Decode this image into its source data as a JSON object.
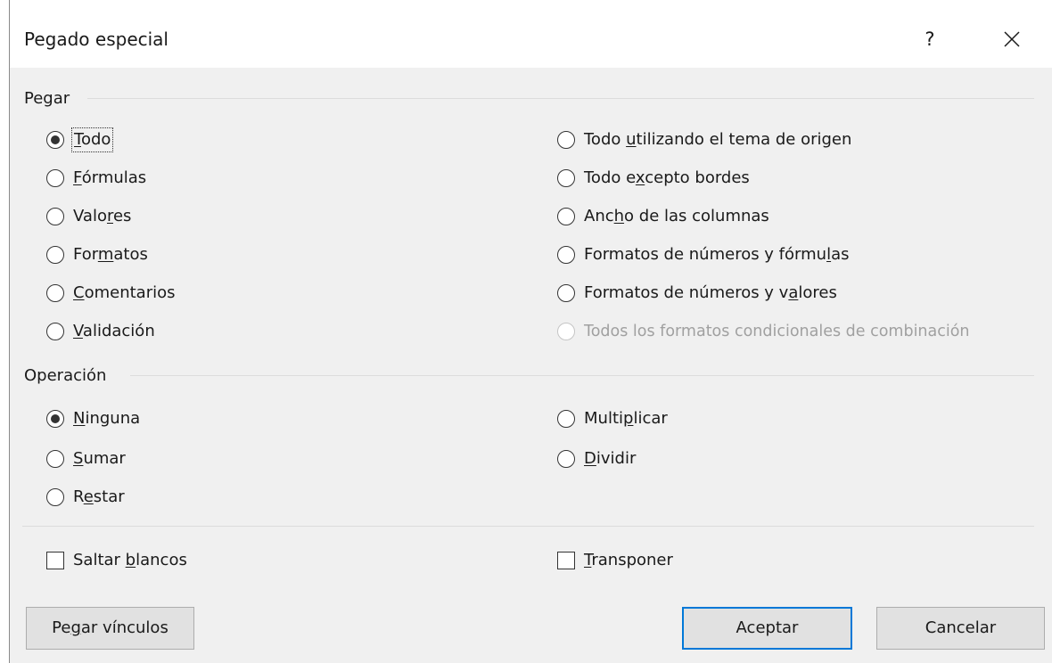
{
  "dialog": {
    "title": "Pegado especial",
    "help_label": "?",
    "close_icon": "close-icon"
  },
  "paste": {
    "label": "Pegar",
    "left_options": [
      {
        "pre": "",
        "key": "T",
        "post": "odo",
        "checked": true,
        "disabled": false
      },
      {
        "pre": "",
        "key": "F",
        "post": "órmulas",
        "checked": false,
        "disabled": false
      },
      {
        "pre": "Valo",
        "key": "r",
        "post": "es",
        "checked": false,
        "disabled": false
      },
      {
        "pre": "For",
        "key": "m",
        "post": "atos",
        "checked": false,
        "disabled": false
      },
      {
        "pre": "",
        "key": "C",
        "post": "omentarios",
        "checked": false,
        "disabled": false
      },
      {
        "pre": "",
        "key": "V",
        "post": "alidación",
        "checked": false,
        "disabled": false
      }
    ],
    "right_options": [
      {
        "pre": "Todo ",
        "key": "u",
        "post": "tilizando el tema de origen",
        "checked": false,
        "disabled": false
      },
      {
        "pre": "Todo e",
        "key": "x",
        "post": "cepto bordes",
        "checked": false,
        "disabled": false
      },
      {
        "pre": "Anc",
        "key": "h",
        "post": "o de las columnas",
        "checked": false,
        "disabled": false
      },
      {
        "pre": "Formatos de números y fórmu",
        "key": "l",
        "post": "as",
        "checked": false,
        "disabled": false
      },
      {
        "pre": "Formatos de números y v",
        "key": "a",
        "post": "lores",
        "checked": false,
        "disabled": false
      },
      {
        "pre": "Todos los formatos condicionales de combinación",
        "key": "",
        "post": "",
        "checked": false,
        "disabled": true
      }
    ]
  },
  "operation": {
    "label": "Operación",
    "left_options": [
      {
        "pre": "",
        "key": "N",
        "post": "inguna",
        "checked": true
      },
      {
        "pre": "",
        "key": "S",
        "post": "umar",
        "checked": false
      },
      {
        "pre": "R",
        "key": "e",
        "post": "star",
        "checked": false
      }
    ],
    "right_options": [
      {
        "pre": "Multi",
        "key": "p",
        "post": "licar",
        "checked": false
      },
      {
        "pre": "",
        "key": "D",
        "post": "ividir",
        "checked": false
      }
    ]
  },
  "checkboxes": {
    "skip_blanks": {
      "pre": "Saltar ",
      "key": "b",
      "post": "lancos",
      "checked": false
    },
    "transpose": {
      "pre": "",
      "key": "T",
      "post": "ransponer",
      "checked": false
    }
  },
  "buttons": {
    "paste_link": {
      "pre": "Pe",
      "key": "g",
      "post": "ar vínculos"
    },
    "ok": "Aceptar",
    "cancel": "Cancelar"
  },
  "colors": {
    "accent": "#0078d7",
    "dialog_bg": "#f0f0f0",
    "title_bg": "#ffffff",
    "disabled_text": "#a0a0a0"
  }
}
